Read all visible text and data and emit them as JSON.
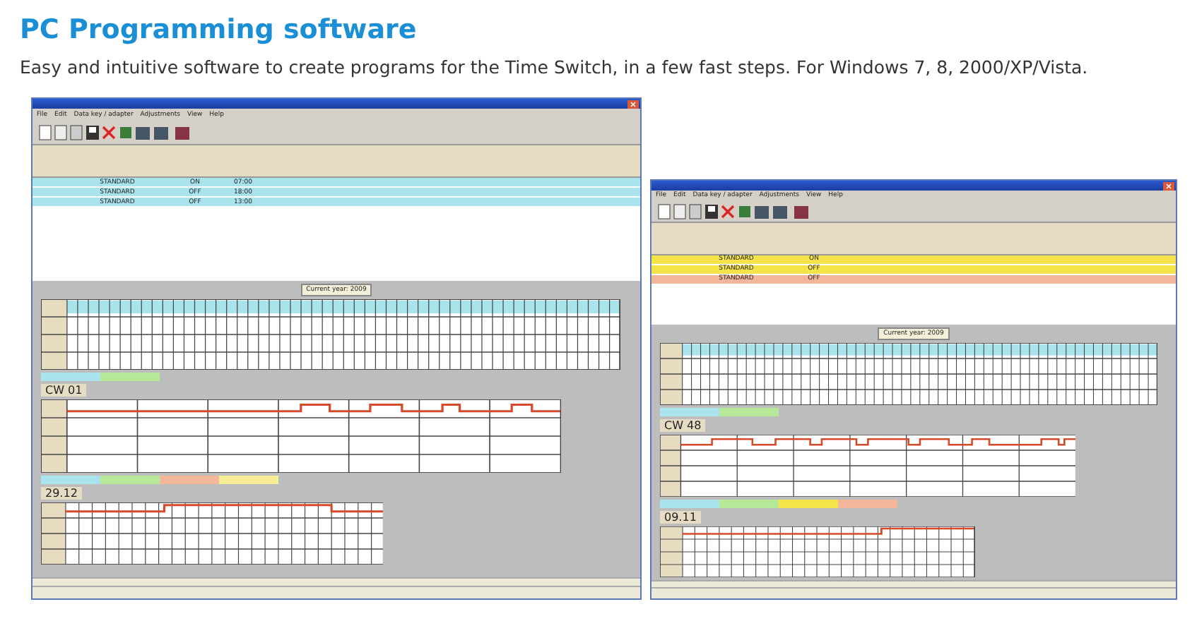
{
  "heading": "PC Programming software",
  "intro": "Easy and intuitive software to create programs for the Time Switch, in a few fast steps. For Windows 7, 8, 2000/XP/Vista.",
  "windows": [
    {
      "menu": [
        "File",
        "Edit",
        "Data key / adapter",
        "Adjustments",
        "View",
        "Help"
      ],
      "rows": [
        {
          "type": "STANDARD",
          "state": "ON",
          "time": "07:00",
          "color": "#a9e3ec"
        },
        {
          "type": "STANDARD",
          "state": "OFF",
          "time": "18:00",
          "color": "#a9e3ec"
        },
        {
          "type": "STANDARD",
          "state": "OFF",
          "time": "13:00",
          "color": "#a9e3ec"
        }
      ],
      "year_label": "Current year: 2009",
      "week_label": "CW 01",
      "day_label": "29.12",
      "legend": [
        {
          "color": "#a9e3ec"
        },
        {
          "color": "#b6e89a"
        },
        {
          "color": "#f4b69a"
        },
        {
          "color": "#f8ee9a"
        }
      ]
    },
    {
      "menu": [
        "File",
        "Edit",
        "Data key / adapter",
        "Adjustments",
        "View",
        "Help"
      ],
      "rows": [
        {
          "type": "STANDARD",
          "state": "ON",
          "time": "",
          "color": "#f5e34a"
        },
        {
          "type": "STANDARD",
          "state": "OFF",
          "time": "",
          "color": "#f5e34a"
        },
        {
          "type": "STANDARD",
          "state": "OFF",
          "time": "",
          "color": "#f4b69a"
        }
      ],
      "year_label": "Current year: 2009",
      "week_label": "CW 48",
      "day_label": "09.11",
      "legend": [
        {
          "color": "#a9e3ec"
        },
        {
          "color": "#b6e89a"
        },
        {
          "color": "#f5e34a"
        },
        {
          "color": "#f4b69a"
        }
      ]
    }
  ]
}
